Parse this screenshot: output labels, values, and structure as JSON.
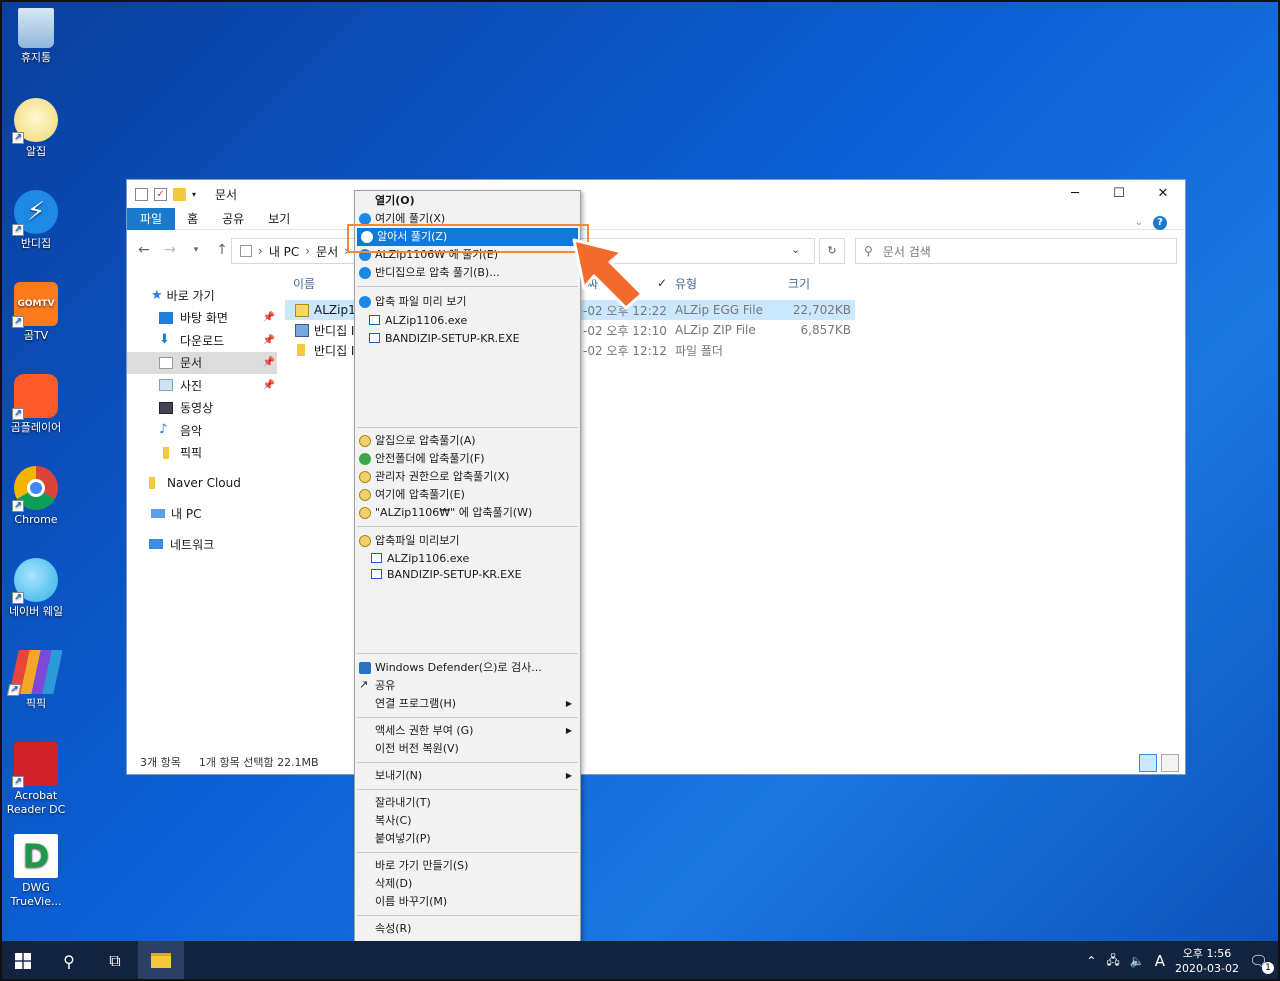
{
  "desktop": {
    "icons": [
      {
        "label": "휴지통",
        "icon": "recycle-bin-icon",
        "color": "#6aa2d8"
      },
      {
        "label": "알집",
        "icon": "alzip-icon",
        "color": "#f4e6a8"
      },
      {
        "label": "반디집",
        "icon": "bandizip-icon",
        "color": "#1e88e5"
      },
      {
        "label": "곰TV",
        "icon": "gomtv-icon",
        "color": "#ff7a1a"
      },
      {
        "label": "곰플레이어",
        "icon": "gomplayer-icon",
        "color": "#ff5a2a"
      },
      {
        "label": "Chrome",
        "icon": "chrome-icon",
        "color": "#ffffff"
      },
      {
        "label": "네이버 웨일",
        "icon": "naver-whale-icon",
        "color": "#2fb0e8"
      },
      {
        "label": "픽픽",
        "icon": "picpick-icon",
        "color": "#7b4bd8"
      },
      {
        "label": "Acrobat Reader DC",
        "icon": "acrobat-icon",
        "color": "#d32027"
      },
      {
        "label": "DWG TrueVie...",
        "icon": "dwg-trueview-icon",
        "color": "#ffffff"
      }
    ]
  },
  "explorer": {
    "title": "문서",
    "ribbon_tabs": [
      "파일",
      "홈",
      "공유",
      "보기"
    ],
    "address": {
      "crumbs": [
        "내 PC",
        "문서"
      ]
    },
    "search_placeholder": "문서 검색",
    "nav": [
      {
        "label": "바로 가기",
        "icon": "star-icon",
        "pinned": false
      },
      {
        "label": "바탕 화면",
        "icon": "desktop-icon",
        "pinned": true
      },
      {
        "label": "다운로드",
        "icon": "download-icon",
        "pinned": true
      },
      {
        "label": "문서",
        "icon": "documents-icon",
        "pinned": true,
        "selected": true
      },
      {
        "label": "사진",
        "icon": "pictures-icon",
        "pinned": true
      },
      {
        "label": "동영상",
        "icon": "videos-icon",
        "pinned": false
      },
      {
        "label": "음악",
        "icon": "music-icon",
        "pinned": false
      },
      {
        "label": "픽픽",
        "icon": "folder-icon",
        "pinned": false
      },
      {
        "label": "Naver Cloud",
        "icon": "folder-icon",
        "pinned": false
      },
      {
        "label": "내 PC",
        "icon": "pc-icon",
        "pinned": false
      },
      {
        "label": "네트워크",
        "icon": "network-icon",
        "pinned": false
      }
    ],
    "columns": {
      "name": "이름",
      "date": "짜",
      "type": "유형",
      "size": "크기"
    },
    "files": [
      {
        "name": "ALZip11",
        "date": "-02 오후 12:22",
        "type": "ALZip EGG File",
        "size": "22,702KB",
        "selected": true
      },
      {
        "name": "반디집 I",
        "date": "-02 오후 12:10",
        "type": "ALZip ZIP File",
        "size": "6,857KB",
        "selected": false
      },
      {
        "name": "반디집 I",
        "date": "-02 오후 12:12",
        "type": "파일 폴더",
        "size": "",
        "selected": false
      }
    ],
    "status": {
      "count": "3개 항목",
      "selection": "1개 항목 선택함 22.1MB"
    }
  },
  "context_menu": {
    "items": [
      {
        "label": "열기(O)",
        "bold": true
      },
      {
        "label": "여기에 풀기(X)"
      },
      {
        "label": "알아서 풀기(Z)",
        "highlighted": true
      },
      {
        "label": "ALZip1106₩ 에 풀기(E)"
      },
      {
        "label": "반디집으로 압축 풀기(B)..."
      },
      {
        "label": "압축 파일 미리 보기"
      },
      {
        "label": "ALZip1106.exe"
      },
      {
        "label": "BANDIZIP-SETUP-KR.EXE"
      },
      {
        "label": "알집으로 압축풀기(A)"
      },
      {
        "label": "안전폴더에 압축풀기(F)"
      },
      {
        "label": "관리자 권한으로 압축풀기(X)"
      },
      {
        "label": "여기에 압축풀기(E)"
      },
      {
        "label": "\"ALZip1106₩\" 에 압축풀기(W)"
      },
      {
        "label": "압축파일 미리보기"
      },
      {
        "label": "ALZip1106.exe"
      },
      {
        "label": "BANDIZIP-SETUP-KR.EXE"
      },
      {
        "label": "Windows Defender(으)로 검사..."
      },
      {
        "label": "공유"
      },
      {
        "label": "연결 프로그램(H)"
      },
      {
        "label": "액세스 권한 부여 (G)"
      },
      {
        "label": "이전 버전 복원(V)"
      },
      {
        "label": "보내기(N)"
      },
      {
        "label": "잘라내기(T)"
      },
      {
        "label": "복사(C)"
      },
      {
        "label": "붙여넣기(P)"
      },
      {
        "label": "바로 가기 만들기(S)"
      },
      {
        "label": "삭제(D)"
      },
      {
        "label": "이름 바꾸기(M)"
      },
      {
        "label": "속성(R)"
      }
    ]
  },
  "taskbar": {
    "time": "오후 1:56",
    "date": "2020-03-02",
    "ime": "A",
    "notification_count": "1"
  },
  "colors": {
    "accent": "#1979ca",
    "highlight": "#1379d8",
    "callout": "#f08a34"
  }
}
